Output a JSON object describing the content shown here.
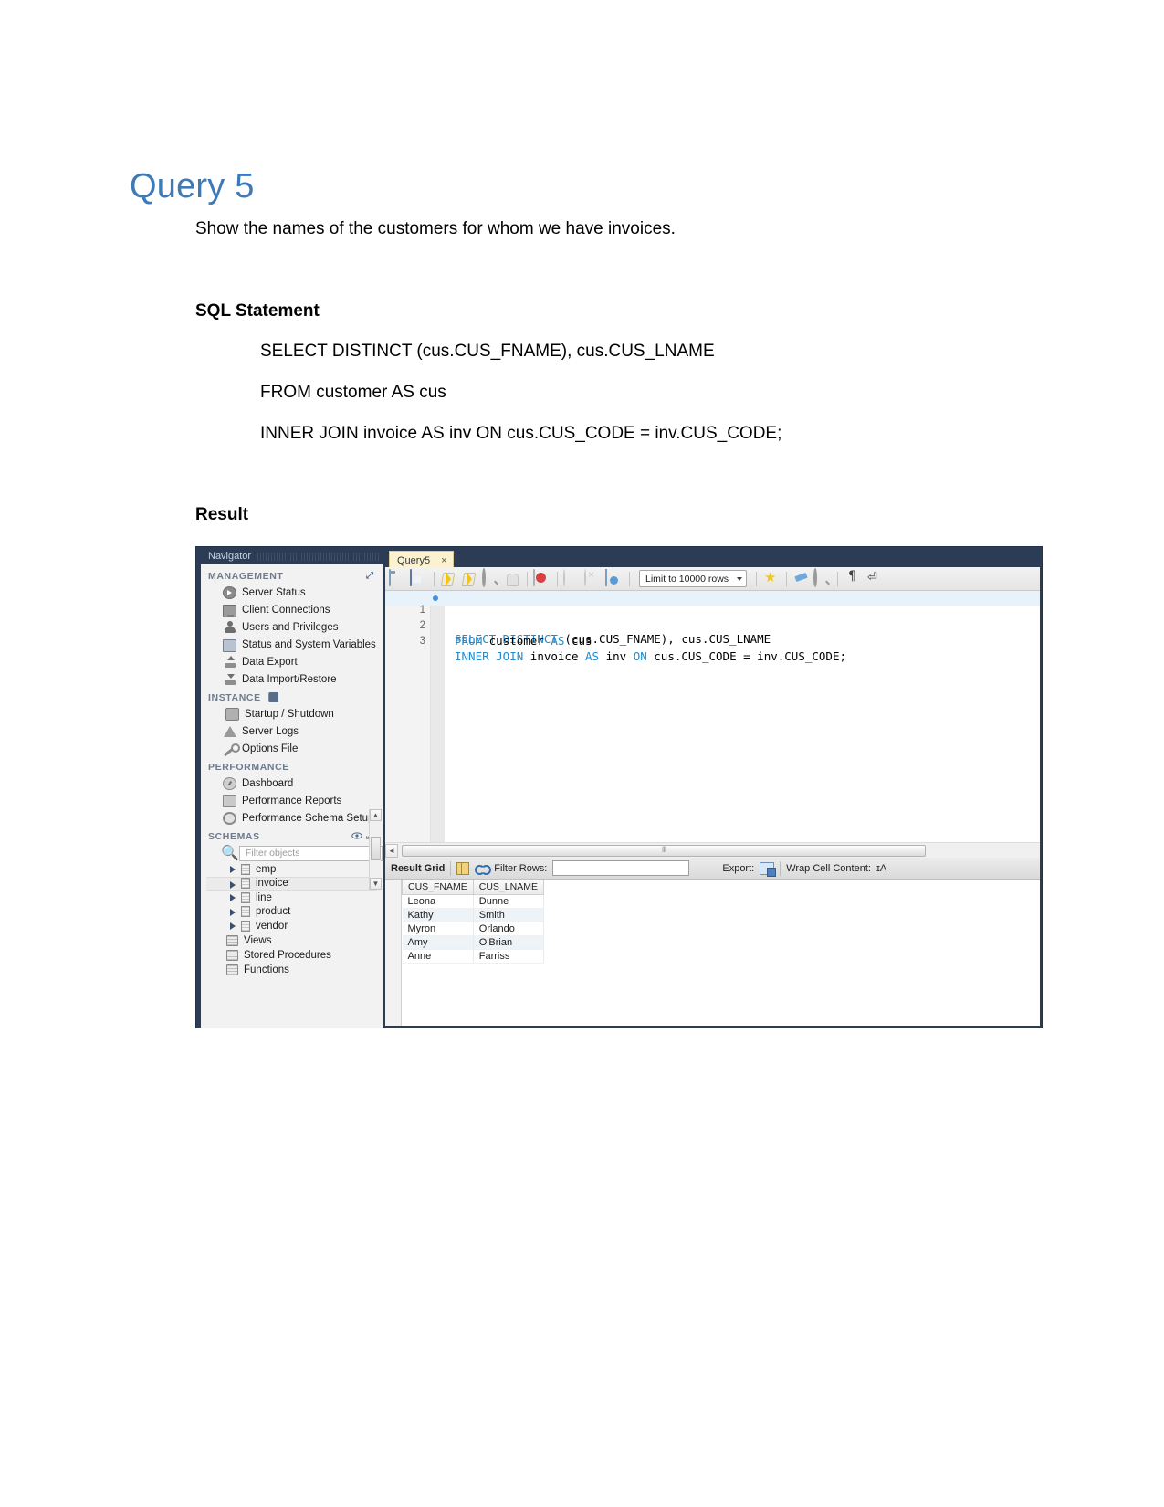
{
  "document": {
    "title": "Query 5",
    "intro": "Show the names of the customers for whom we have invoices.",
    "sql_heading": "SQL Statement",
    "sql_lines": [
      "SELECT DISTINCT (cus.CUS_FNAME), cus.CUS_LNAME",
      "FROM customer AS cus",
      "INNER JOIN invoice AS inv ON cus.CUS_CODE = inv.CUS_CODE;"
    ],
    "result_heading": "Result"
  },
  "workbench": {
    "navigator": {
      "title": "Navigator",
      "groups": [
        {
          "label": "MANAGEMENT",
          "items": [
            {
              "label": "Server Status",
              "icon": "server-status-icon"
            },
            {
              "label": "Client Connections",
              "icon": "client-connections-icon"
            },
            {
              "label": "Users and Privileges",
              "icon": "users-privileges-icon"
            },
            {
              "label": "Status and System Variables",
              "icon": "status-variables-icon"
            },
            {
              "label": "Data Export",
              "icon": "data-export-icon"
            },
            {
              "label": "Data Import/Restore",
              "icon": "data-import-icon"
            }
          ]
        },
        {
          "label": "INSTANCE",
          "items": [
            {
              "label": "Startup / Shutdown",
              "icon": "power-icon"
            },
            {
              "label": "Server Logs",
              "icon": "warning-icon"
            },
            {
              "label": "Options File",
              "icon": "wrench-icon"
            }
          ]
        },
        {
          "label": "PERFORMANCE",
          "items": [
            {
              "label": "Dashboard",
              "icon": "dashboard-icon"
            },
            {
              "label": "Performance Reports",
              "icon": "reports-icon"
            },
            {
              "label": "Performance Schema Setup",
              "icon": "schema-setup-icon"
            }
          ]
        },
        {
          "label": "SCHEMAS",
          "items": []
        }
      ],
      "filter_placeholder": "Filter objects",
      "tables": [
        {
          "label": "emp",
          "selected": false
        },
        {
          "label": "invoice",
          "selected": true
        },
        {
          "label": "line",
          "selected": false
        },
        {
          "label": "product",
          "selected": false
        },
        {
          "label": "vendor",
          "selected": false
        }
      ],
      "folders": [
        {
          "label": "Views"
        },
        {
          "label": "Stored Procedures"
        },
        {
          "label": "Functions"
        }
      ]
    },
    "editor": {
      "tab_label": "Query5",
      "tab_close": "×",
      "limit_label": "Limit to 10000 rows",
      "lines": [
        {
          "number": "1",
          "parts": [
            {
              "t": "SELECT DISTINCT ",
              "kw": true
            },
            {
              "t": "(cus.CUS_FNAME), cus.CUS_LNAME",
              "kw": false
            }
          ]
        },
        {
          "number": "2",
          "parts": [
            {
              "t": "FROM ",
              "kw": true
            },
            {
              "t": "customer ",
              "kw": false
            },
            {
              "t": "AS ",
              "kw": true
            },
            {
              "t": "cus",
              "kw": false
            }
          ]
        },
        {
          "number": "3",
          "parts": [
            {
              "t": "INNER JOIN ",
              "kw": true
            },
            {
              "t": "invoice ",
              "kw": false
            },
            {
              "t": "AS ",
              "kw": true
            },
            {
              "t": "inv ",
              "kw": false
            },
            {
              "t": "ON ",
              "kw": true
            },
            {
              "t": "cus.CUS_CODE = inv.CUS_CODE;",
              "kw": false
            }
          ]
        }
      ]
    },
    "results": {
      "toolbar": {
        "result_grid_label": "Result Grid",
        "filter_rows_label": "Filter Rows:",
        "filter_value": "",
        "export_label": "Export:",
        "wrap_label": "Wrap Cell Content:",
        "wrap_icon": "ɪA"
      },
      "columns": [
        "CUS_FNAME",
        "CUS_LNAME"
      ],
      "rows": [
        [
          "Leona",
          "Dunne"
        ],
        [
          "Kathy",
          "Smith"
        ],
        [
          "Myron",
          "Orlando"
        ],
        [
          "Amy",
          "O'Brian"
        ],
        [
          "Anne",
          "Farriss"
        ]
      ]
    },
    "colors": {
      "chrome": "#2c3c55",
      "keyword": "#1f8bd0",
      "tab_active": "#fdf2cf",
      "selection": "#e8f2fb"
    }
  }
}
